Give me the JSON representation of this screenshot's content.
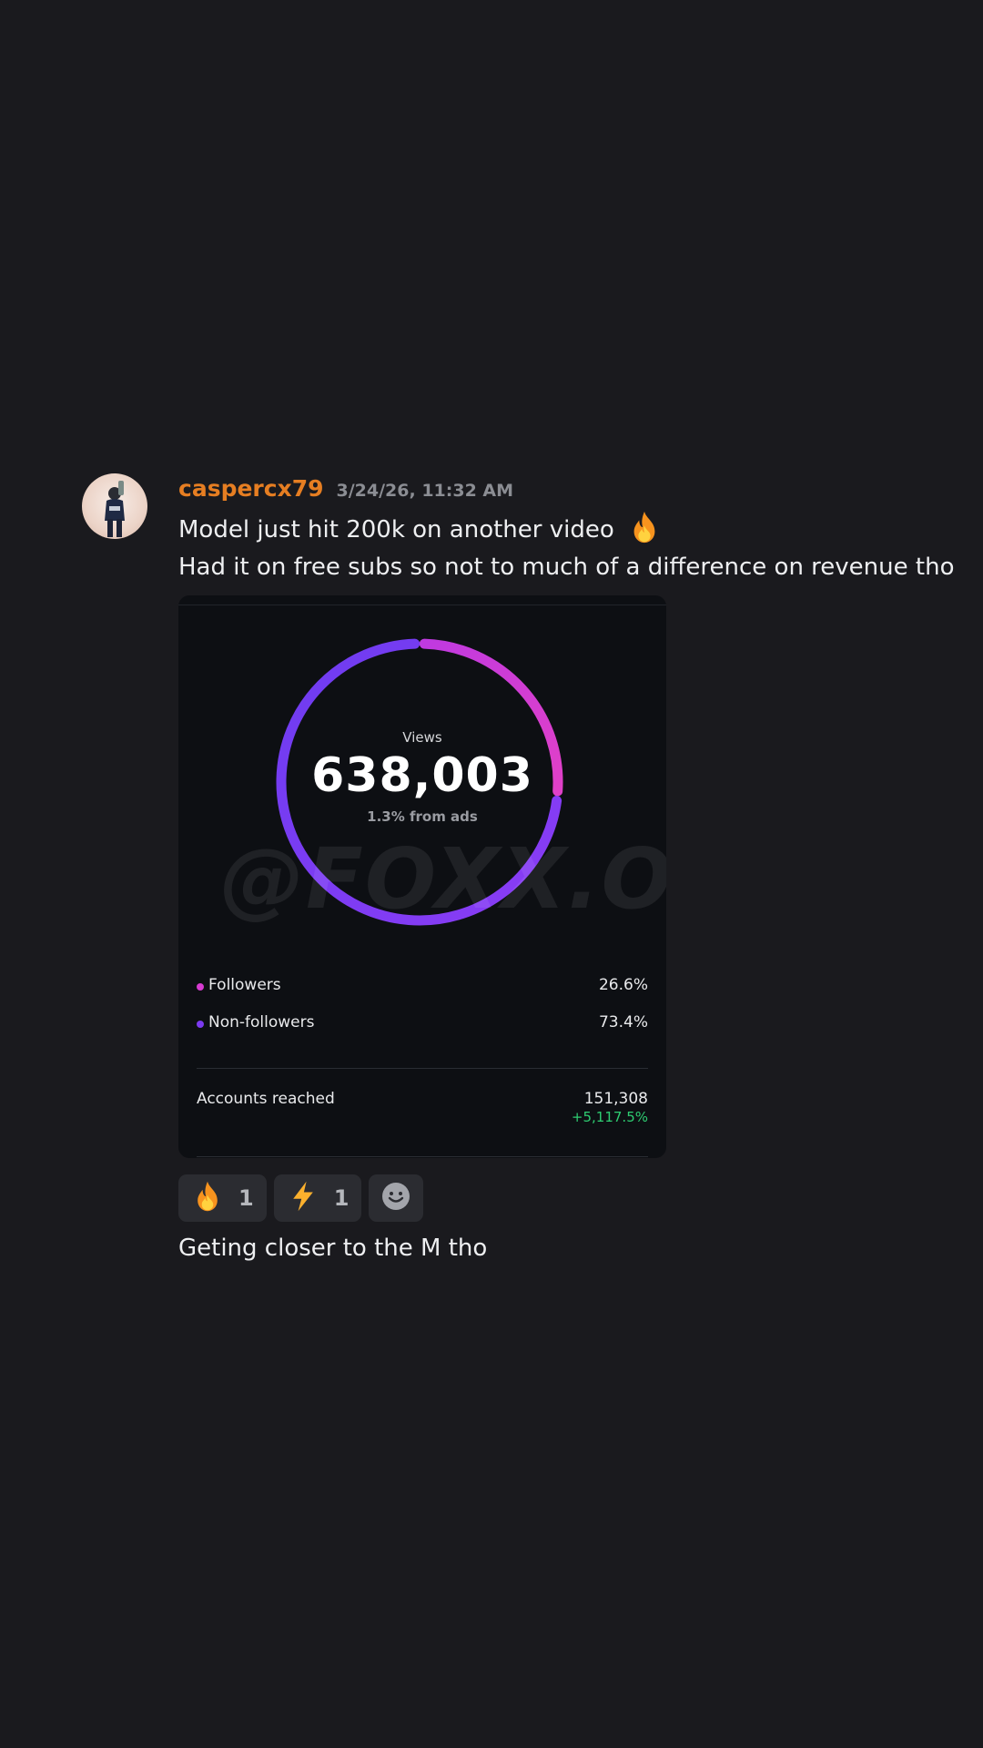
{
  "message": {
    "username": "caspercx79",
    "timestamp": "3/24/26, 11:32 AM",
    "lines": [
      "Model just hit 200k on another video",
      "Had it on free subs so not to much of a difference on revenue tho"
    ],
    "line1_emoji": "fire-emoji",
    "username_color": "#e67e22"
  },
  "insights_card": {
    "views_label": "Views",
    "views_value": "638,003",
    "ads_note": "1.3% from ads",
    "watermark": "@FOXX.OFM",
    "legend": [
      {
        "label": "Followers",
        "percent": "26.6%",
        "color": "#d63bd1"
      },
      {
        "label": "Non-followers",
        "percent": "73.4%",
        "color": "#7b3af0"
      }
    ],
    "accounts_reached_label": "Accounts reached",
    "accounts_reached_value": "151,308",
    "accounts_reached_change": "+5,117.5%",
    "change_color": "#2ecc71"
  },
  "chart_data": {
    "type": "pie",
    "categories": [
      "Followers",
      "Non-followers"
    ],
    "values": [
      26.6,
      73.4
    ]
  },
  "reactions": [
    {
      "icon": "fire-emoji",
      "count": "1"
    },
    {
      "icon": "lightning-emoji",
      "count": "1"
    },
    {
      "icon": "add-reaction-icon"
    }
  ],
  "follow_up": {
    "text": "Geting closer to the M tho"
  }
}
